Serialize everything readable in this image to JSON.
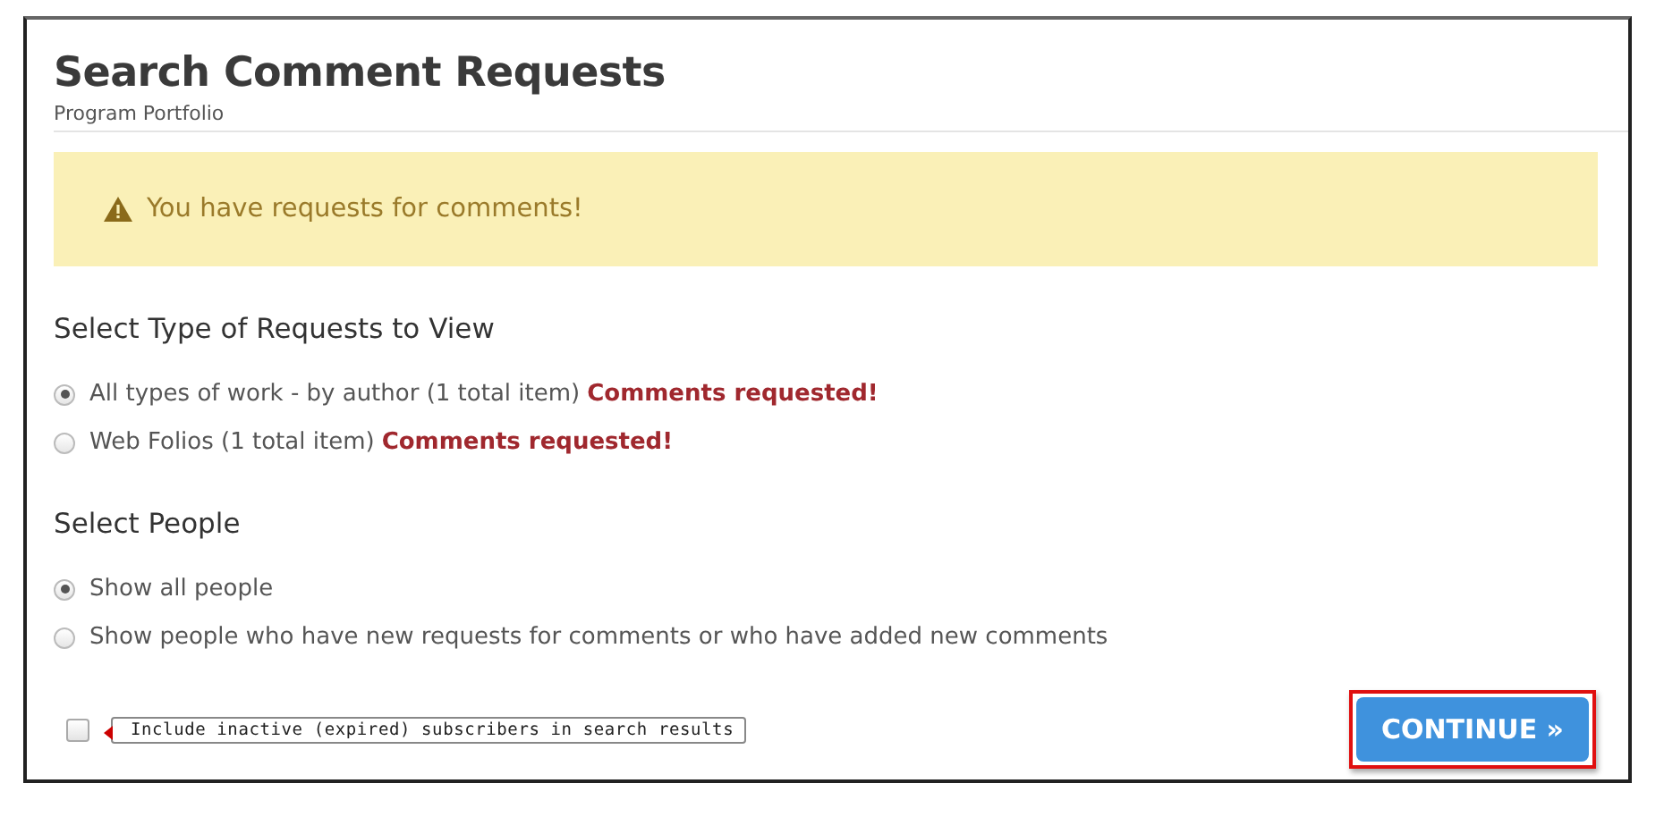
{
  "title": "Search Comment Requests",
  "subtitle": "Program Portfolio",
  "alert": {
    "text": "You have requests for comments!"
  },
  "sections": [
    {
      "heading": "Select Type of Requests to View",
      "options": [
        {
          "label": "All types of work - by author (1 total item)",
          "note": "Comments requested!",
          "selected": true
        },
        {
          "label": "Web Folios (1 total item)",
          "note": "Comments requested!",
          "selected": false
        }
      ]
    },
    {
      "heading": "Select People",
      "options": [
        {
          "label": "Show all people",
          "selected": true
        },
        {
          "label": "Show people who have new requests for comments or who have added new comments",
          "selected": false
        }
      ]
    }
  ],
  "inactive_option": {
    "checked": false,
    "tooltip": "Include inactive (expired) subscribers in search results"
  },
  "continue_button": {
    "label": "CONTINUE »",
    "highlighted": true
  }
}
